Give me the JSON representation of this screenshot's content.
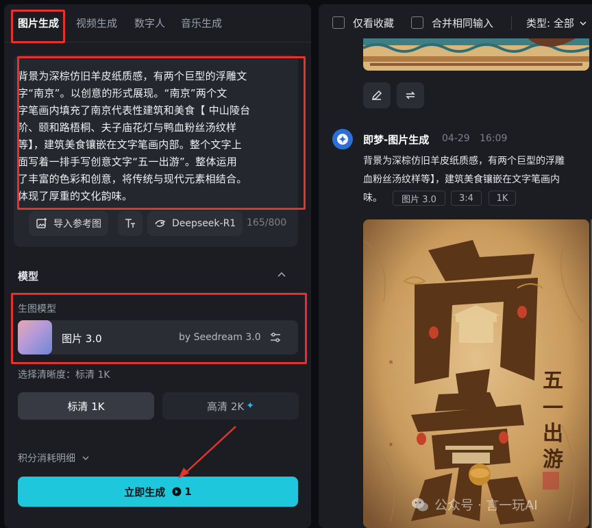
{
  "tabs": [
    "图片生成",
    "视频生成",
    "数字人",
    "音乐生成"
  ],
  "prompt": {
    "lines": [
      "背景为深棕仿旧羊皮纸质感，有两个巨型的浮雕文",
      "字“南京”。以创意的形式展现。“南京”两个文",
      "字笔画内填充了南京代表性建筑和美食【 中山陵台",
      "阶、颐和路梧桐、夫子庙花灯与鸭血粉丝汤纹样",
      "等】，建筑美食镶嵌在文字笔画内部。整个文字上",
      "面写着一排手写创意文字“五一出游”。整体运用",
      "了丰富的色彩和创意，将传统与现代元素相结合。",
      "体现了厚重的文化韵味。"
    ],
    "ref_image_label": "导入参考图",
    "deepseek_label": "Deepseek-R1",
    "counter": "165/800"
  },
  "model_section": {
    "title": "模型",
    "sub_label": "生图模型",
    "model_name": "图片 3.0",
    "model_by": "by Seedream 3.0"
  },
  "resolution": {
    "label": "选择清晰度：标清 1K",
    "options": [
      "标清 1K",
      "高清 2K"
    ],
    "selected": "标清 1K",
    "sparkle": "✦"
  },
  "cost_label": "积分消耗明细",
  "generate": {
    "label": "立即生成",
    "credits": "1"
  },
  "right": {
    "filter_fav": "仅看收藏",
    "filter_merge": "合并相同输入",
    "type_label": "类型: 全部",
    "message": {
      "title": "即梦-图片生成",
      "date": "04-29",
      "time": "16:09",
      "line1": "背景为深棕仿旧羊皮纸质感，有两个巨型的浮雕",
      "line2": "血粉丝汤纹样等】，建筑美食镶嵌在文字笔画内",
      "line3": "味。",
      "tags": [
        "图片 3.0",
        "3:4",
        "1K"
      ]
    },
    "poster_text": {
      "big1": "南",
      "big2": "京",
      "vertical": [
        "五",
        "一",
        "出",
        "游"
      ]
    },
    "watermark": "公众号 · 言一玩AI"
  },
  "colors": {
    "accent_cyan": "#1ec7db",
    "highlight_red": "#e5322d",
    "panel_bg": "#1b1d22"
  }
}
